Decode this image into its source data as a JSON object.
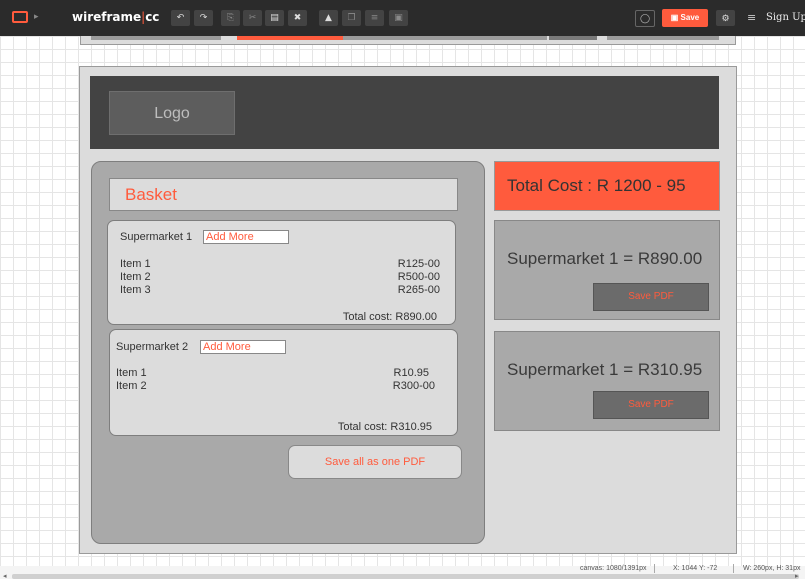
{
  "toolbar": {
    "brand_main": "wireframe",
    "brand_sep": "|",
    "brand_suffix": "cc",
    "tools": [
      {
        "name": "undo-icon",
        "glyph": "↶"
      },
      {
        "name": "redo-icon",
        "glyph": "↷"
      },
      {
        "name": "copy-icon",
        "glyph": "⎘"
      },
      {
        "name": "cut-icon",
        "glyph": "✂"
      },
      {
        "name": "paste-icon",
        "glyph": "▤"
      },
      {
        "name": "delete-icon",
        "glyph": "✖"
      },
      {
        "name": "lock-icon",
        "glyph": "▲"
      },
      {
        "name": "group-icon",
        "glyph": "❐"
      },
      {
        "name": "align-icon",
        "glyph": "≡"
      },
      {
        "name": "arrange-icon",
        "glyph": "▣"
      }
    ],
    "comment_glyph": "◯",
    "save_label": "Save",
    "save_glyph": "▣",
    "share_glyph": "⚙",
    "menu_glyph": "≡",
    "signup_label": "Sign Up"
  },
  "wireframe": {
    "logo_label": "Logo",
    "basket_title": "Basket",
    "supermarkets": [
      {
        "name": "Supermarket 1",
        "add_more": "Add More",
        "items": [
          {
            "name": "Item 1",
            "price": "R125-00"
          },
          {
            "name": "Item 2",
            "price": "R500-00"
          },
          {
            "name": "Item 3",
            "price": "R265-00"
          }
        ],
        "total": "Total cost: R890.00"
      },
      {
        "name": "Supermarket 2",
        "add_more": "Add More",
        "items": [
          {
            "name": "Item 1",
            "price": "R10.95"
          },
          {
            "name": "Item 2",
            "price": "R300-00"
          }
        ],
        "total": "Total cost: R310.95"
      }
    ],
    "save_all_label": "Save all as one PDF",
    "total_cost": "Total Cost : R 1200 - 95",
    "summaries": [
      {
        "text": "Supermarket 1 = R890.00",
        "pdf_label": "Save PDF"
      },
      {
        "text": "Supermarket 1 = R310.95",
        "pdf_label": "Save PDF"
      }
    ]
  },
  "status": {
    "canvas": "canvas: 1080/1391px",
    "coords": "X: 1044 Y: -72",
    "size": "W: 260px, H: 31px"
  },
  "colors": {
    "accent": "#ff5b3d",
    "dark": "#434343",
    "panel": "#a9a9a9",
    "light": "#dcdcdc"
  }
}
